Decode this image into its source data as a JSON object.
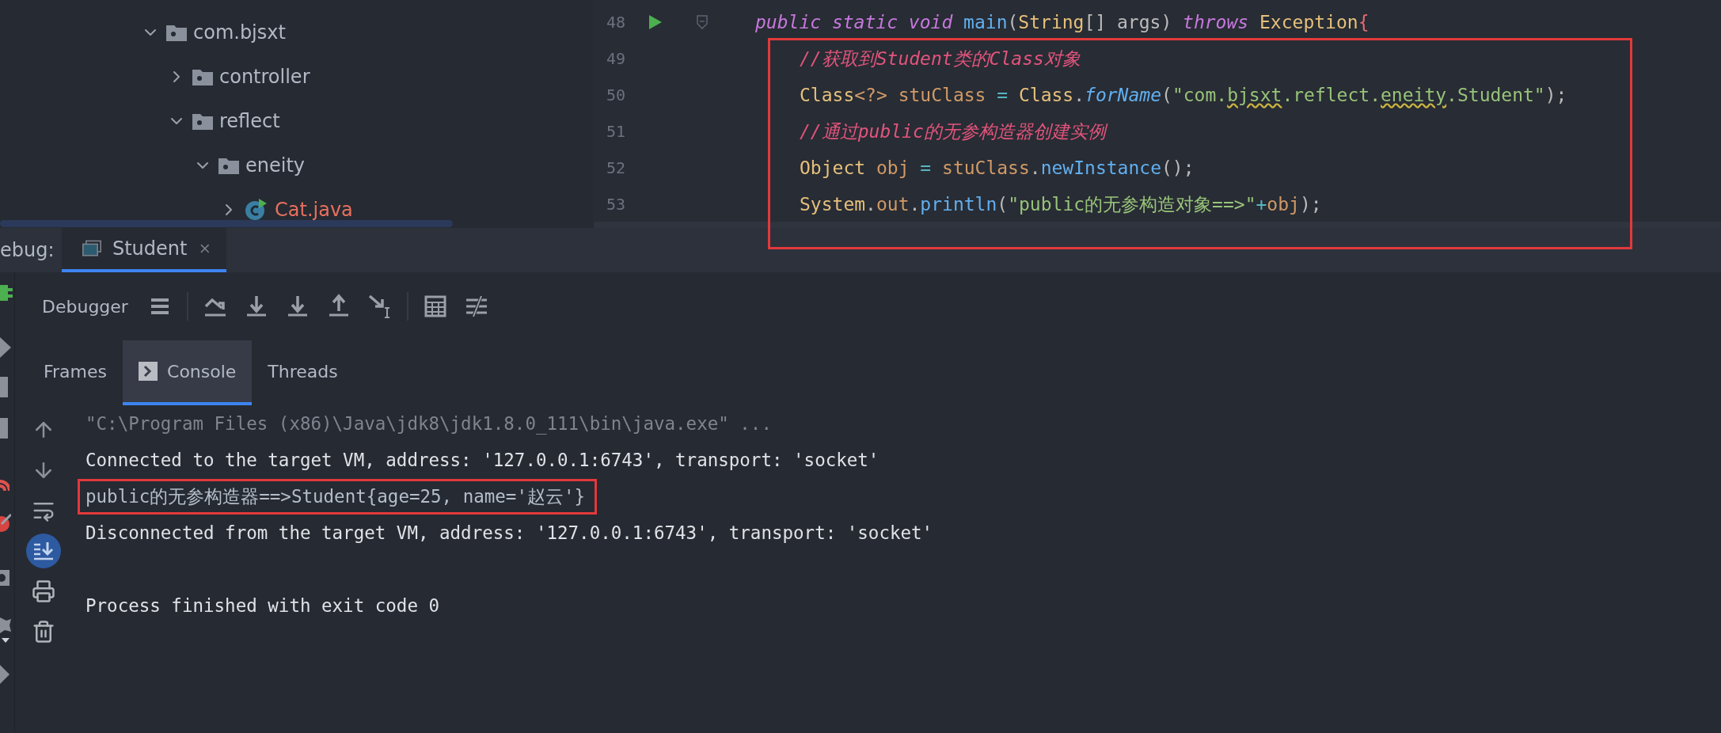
{
  "project_tree": {
    "items": [
      {
        "label": "com.bjsxt",
        "kind": "package",
        "expanded": true,
        "children": [
          {
            "label": "controller",
            "kind": "package",
            "expanded": false
          },
          {
            "label": "reflect",
            "kind": "package",
            "expanded": true,
            "children": [
              {
                "label": "eneity",
                "kind": "package",
                "expanded": true,
                "children": [
                  {
                    "label": "Cat.java",
                    "kind": "class",
                    "expanded": false
                  }
                ]
              }
            ]
          }
        ]
      }
    ]
  },
  "editor": {
    "lines": [
      {
        "number": "48",
        "run": true,
        "boxed": false,
        "tokens": [
          {
            "text": "public static void ",
            "kind": "keyword"
          },
          {
            "text": "main",
            "kind": "method"
          },
          {
            "text": "(",
            "kind": "plain"
          },
          {
            "text": "String",
            "kind": "type"
          },
          {
            "text": "[] args) ",
            "kind": "plain"
          },
          {
            "text": "throws ",
            "kind": "keyword"
          },
          {
            "text": "Exception",
            "kind": "type"
          },
          {
            "text": "{",
            "kind": "brace"
          }
        ]
      },
      {
        "number": "49",
        "run": false,
        "boxed": true,
        "tokens": [
          {
            "text": "//获取到Student类的Class对象",
            "kind": "comment"
          }
        ]
      },
      {
        "number": "50",
        "run": false,
        "boxed": true,
        "tokens": [
          {
            "text": "Class",
            "kind": "type"
          },
          {
            "text": "<?> ",
            "kind": "var"
          },
          {
            "text": "stuClass",
            "kind": "var"
          },
          {
            "text": " = ",
            "kind": "op"
          },
          {
            "text": "Class",
            "kind": "type"
          },
          {
            "text": ".",
            "kind": "plain"
          },
          {
            "text": "forName",
            "kind": "static"
          },
          {
            "text": "(",
            "kind": "plain"
          },
          {
            "text": "\"com.",
            "kind": "string"
          },
          {
            "text": "bjsxt",
            "kind": "typo"
          },
          {
            "text": ".reflect.",
            "kind": "string"
          },
          {
            "text": "eneity",
            "kind": "typo"
          },
          {
            "text": ".Student\"",
            "kind": "string"
          },
          {
            "text": ");",
            "kind": "plain"
          }
        ]
      },
      {
        "number": "51",
        "run": false,
        "boxed": true,
        "tokens": [
          {
            "text": "//通过public的无参构造器创建实例",
            "kind": "comment"
          }
        ]
      },
      {
        "number": "52",
        "run": false,
        "boxed": true,
        "tokens": [
          {
            "text": "Object ",
            "kind": "type"
          },
          {
            "text": "obj",
            "kind": "var"
          },
          {
            "text": " = ",
            "kind": "op"
          },
          {
            "text": "stuClass",
            "kind": "var"
          },
          {
            "text": ".",
            "kind": "plain"
          },
          {
            "text": "newInstance",
            "kind": "method"
          },
          {
            "text": "();",
            "kind": "plain"
          }
        ]
      },
      {
        "number": "53",
        "run": false,
        "boxed": true,
        "tokens": [
          {
            "text": "System",
            "kind": "type"
          },
          {
            "text": ".",
            "kind": "plain"
          },
          {
            "text": "out",
            "kind": "var"
          },
          {
            "text": ".",
            "kind": "plain"
          },
          {
            "text": "println",
            "kind": "method"
          },
          {
            "text": "(",
            "kind": "plain"
          },
          {
            "text": "\"public的无参构造对象==>\"",
            "kind": "string"
          },
          {
            "text": "+",
            "kind": "op"
          },
          {
            "text": "obj",
            "kind": "var"
          },
          {
            "text": ");",
            "kind": "plain"
          }
        ]
      }
    ]
  },
  "debug_panel": {
    "title": "ebug:",
    "tabs": [
      {
        "label": "Student",
        "selected": true
      }
    ],
    "toolbar": {
      "label": "Debugger"
    },
    "subtabs": [
      {
        "label": "Frames",
        "selected": false
      },
      {
        "label": "Console",
        "selected": true
      },
      {
        "label": "Threads",
        "selected": false
      }
    ],
    "console": {
      "lines": [
        {
          "text": "\"C:\\Program Files (x86)\\Java\\jdk8\\jdk1.8.0_111\\bin\\java.exe\" ...",
          "kind": "command",
          "boxed": false
        },
        {
          "text": "Connected to the target VM, address: '127.0.0.1:6743', transport: 'socket'",
          "kind": "system",
          "boxed": false
        },
        {
          "text": "public的无参构造器==>Student{age=25, name='赵云'}",
          "kind": "stdout",
          "boxed": true
        },
        {
          "text": "Disconnected from the target VM, address: '127.0.0.1:6743', transport: 'socket'",
          "kind": "system",
          "boxed": false
        }
      ],
      "exit_message": "Process finished with exit code 0"
    }
  }
}
